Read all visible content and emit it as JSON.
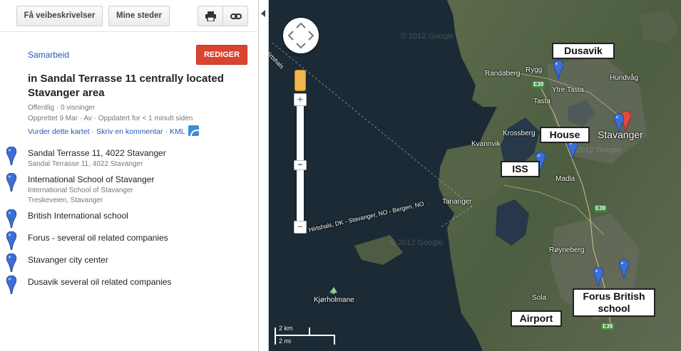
{
  "toolbar": {
    "directions_label": "Få veibeskrivelser",
    "my_places_label": "Mine steder",
    "print_icon": "print-icon",
    "link_icon": "link-icon"
  },
  "panel": {
    "collab_label": "Samarbeid",
    "edit_label": "REDIGER",
    "title": "in Sandal Terrasse 11 centrally located Stavanger area",
    "meta_line1": "Offentlig · 0 visninger",
    "meta_line2": "Opprettet 9 Mar · Av  · Oppdatert for < 1 minutt siden",
    "link_rate": "Vurder dette kartet",
    "link_comment": "Skriv en kommentar",
    "link_kml": "KML",
    "link_sep": "·"
  },
  "places": [
    {
      "name": "Sandal Terrasse 11, 4022 Stavanger",
      "sub1": "Sandal Terrasse 11, 4022 Stavanger",
      "sub2": ""
    },
    {
      "name": "International School of Stavanger",
      "sub1": "International School of Stavanger",
      "sub2": "Treskeveien, Stavanger"
    },
    {
      "name": "British International school",
      "sub1": "",
      "sub2": ""
    },
    {
      "name": "Forus - several oil related companies",
      "sub1": "",
      "sub2": ""
    },
    {
      "name": "Stavanger city center",
      "sub1": "",
      "sub2": ""
    },
    {
      "name": "Dusavik several oil related companies",
      "sub1": "",
      "sub2": ""
    }
  ],
  "map": {
    "labels": {
      "randaberg": "Randaberg",
      "rygg": "Rygg",
      "hundvag": "Hundvåg",
      "ytre_tasta": "Ytre Tasta",
      "tasta": "Tasta",
      "krossberg": "Krossberg",
      "kvannvik": "Kvannvik",
      "stavanger": "Stavanger",
      "madla": "Madla",
      "tananger": "Tananger",
      "royneberg": "Røyneberg",
      "sola": "Sola",
      "kjorholmane": "Kjørholmane"
    },
    "callouts": {
      "dusavik": "Dusavik",
      "house": "House",
      "iss": "ISS",
      "forus": "Forus British school",
      "airport": "Airport"
    },
    "roads": [
      "E39",
      "E39",
      "E39"
    ],
    "route_label": "Hirtshals, DK - Stavanger, NO - Bergen, NO",
    "route_label_top": "Hirtshals",
    "watermark": "© 2012 Google",
    "scale_km": "2 km",
    "scale_mi": "2 mi",
    "zoom_in": "+",
    "zoom_out": "−",
    "zoom_mid": "−"
  },
  "colors": {
    "accent": "#d9432f",
    "link": "#2255bb",
    "pin": "#3b6fd6",
    "sea": "#1c2b36"
  }
}
